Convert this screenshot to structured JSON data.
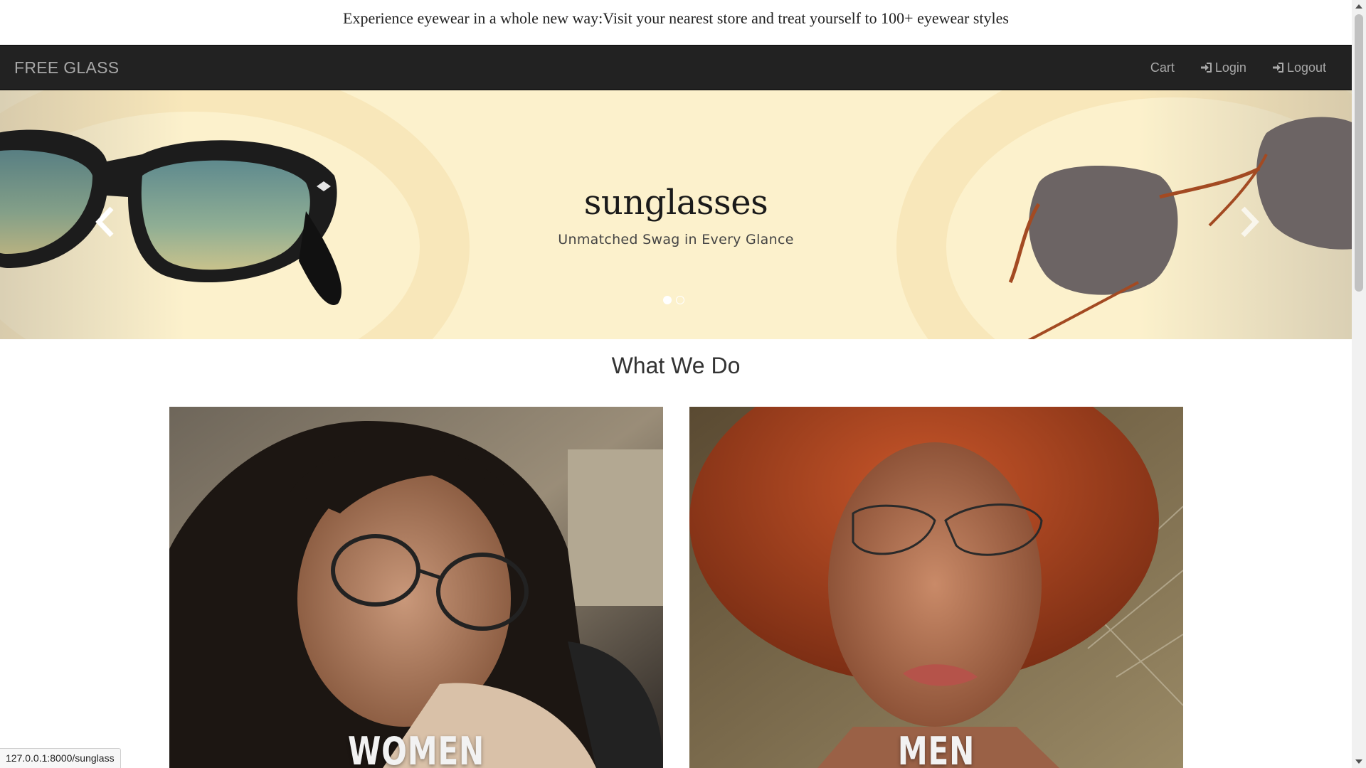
{
  "announcement": "Experience eyewear in a whole new way:Visit your nearest store and treat yourself to 100+ eyewear styles",
  "navbar": {
    "brand": "FREE GLASS",
    "cart": "Cart",
    "login": "Login",
    "logout": "Logout"
  },
  "carousel": {
    "title": "sunglasses",
    "subtitle": "Unmatched Swag in Every Glance",
    "slide_count": 2,
    "active_slide": 1
  },
  "section": {
    "title": "What We Do",
    "cards": [
      {
        "label": "WOMEN"
      },
      {
        "label": "MEN"
      }
    ]
  },
  "status_url": "127.0.0.1:8000/sunglass",
  "colors": {
    "navbar": "#222222",
    "banner": "#fcf1cc",
    "nav_text": "#a8a8a8"
  },
  "icons": {
    "login": "log-in-icon",
    "logout": "log-in-icon",
    "prev": "chevron-left-icon",
    "next": "chevron-right-icon"
  }
}
